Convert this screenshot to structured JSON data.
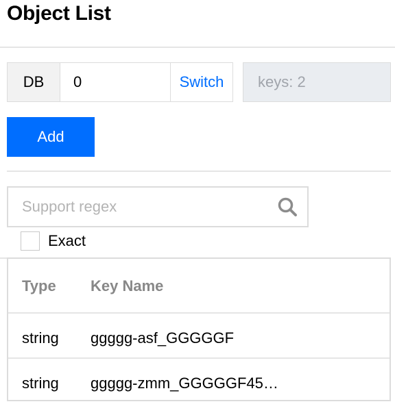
{
  "page": {
    "title": "Object List"
  },
  "db_selector": {
    "label": "DB",
    "value": "0",
    "switch_label": "Switch"
  },
  "keys_info": {
    "text": "keys: 2"
  },
  "toolbar": {
    "add_label": "Add"
  },
  "search": {
    "placeholder": "Support regex",
    "icon": "search-icon",
    "exact_label": "Exact",
    "exact_checked": false
  },
  "table": {
    "headers": {
      "type": "Type",
      "key_name": "Key Name"
    },
    "rows": [
      {
        "type": "string",
        "key_name": "ggggg-asf_GGGGGF"
      },
      {
        "type": "string",
        "key_name": "ggggg-zmm_GGGGGF45…"
      }
    ]
  },
  "colors": {
    "accent": "#006eff",
    "border": "#dcdcdc",
    "disabled_bg": "#eaedf1",
    "header_text": "#888888"
  }
}
